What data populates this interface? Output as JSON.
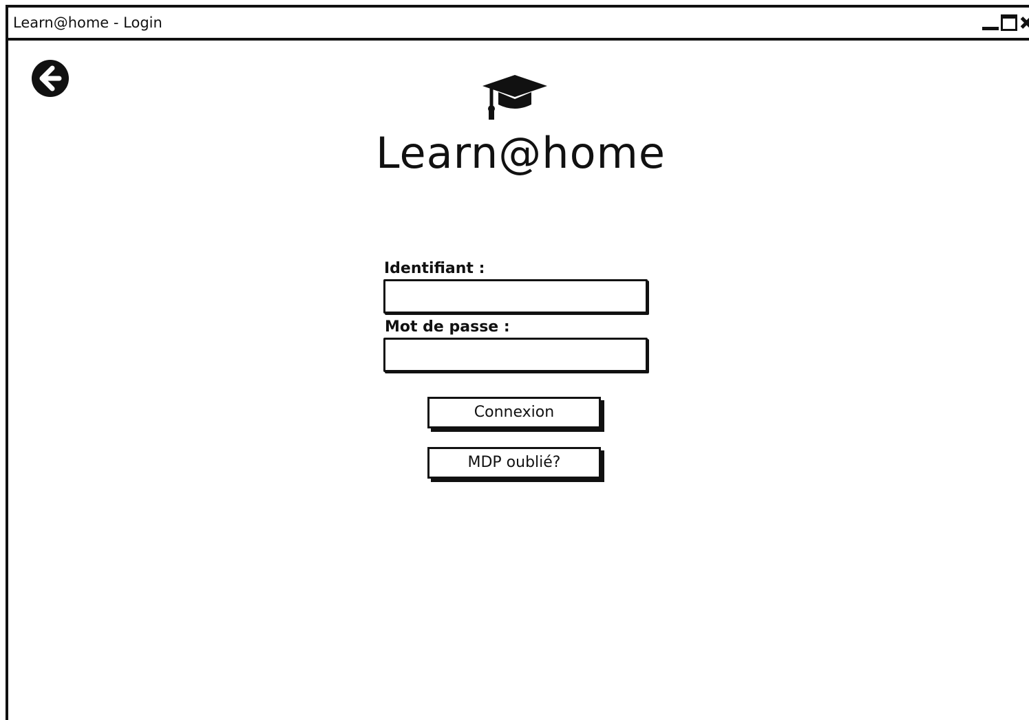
{
  "window": {
    "title": "Learn@home - Login"
  },
  "icons": {
    "back": "arrow-left-circle",
    "logo": "graduation-cap",
    "minimize": "minimize",
    "maximize": "maximize",
    "close": "close"
  },
  "brand": {
    "name": "Learn@home"
  },
  "form": {
    "username_label": "Identifiant :",
    "username_value": "",
    "password_label": "Mot de passe :",
    "password_value": "",
    "login_button": "Connexion",
    "forgot_button": "MDP oublié?"
  }
}
